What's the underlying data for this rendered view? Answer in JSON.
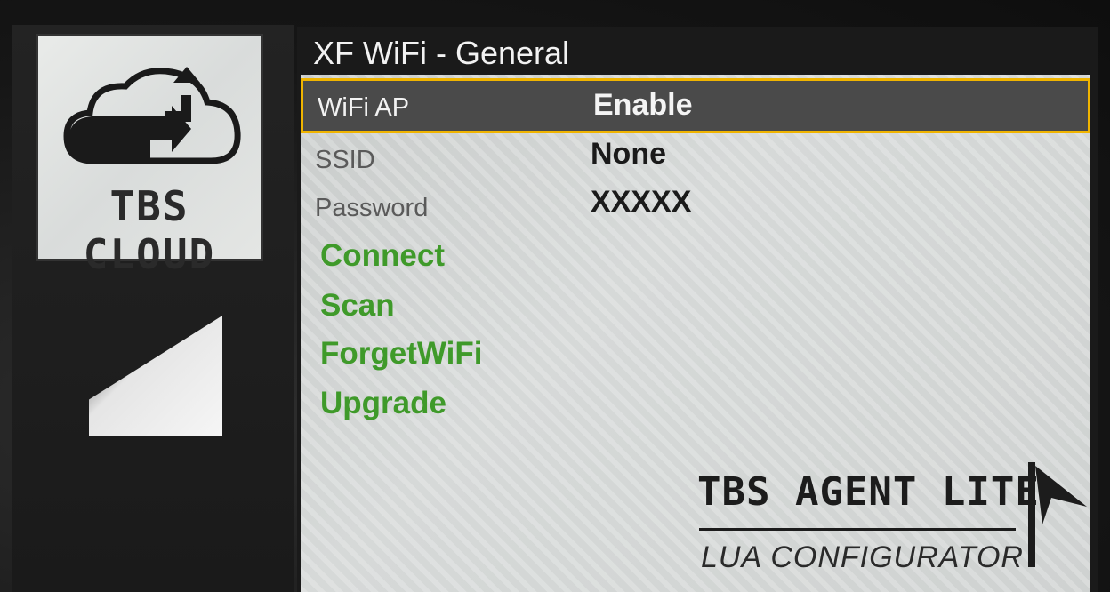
{
  "sidebar": {
    "logo_text": "TBS CLOUD",
    "logo_icon": "cloud-sync-icon"
  },
  "screen": {
    "title": "XF WiFi - General",
    "selected_row_border_color": "#f0b400",
    "action_color": "#3f9a2a",
    "settings": [
      {
        "label": "WiFi AP",
        "value": "Enable"
      },
      {
        "label": "SSID",
        "value": "None"
      },
      {
        "label": "Password",
        "value": "XXXXX"
      }
    ],
    "actions": [
      "Connect",
      "Scan",
      "ForgetWiFi",
      "Upgrade"
    ]
  },
  "branding": {
    "product": "TBS AGENT LITE",
    "subtitle": "LUA CONFIGURATOR",
    "icon": "agent-lite-flag-icon"
  }
}
